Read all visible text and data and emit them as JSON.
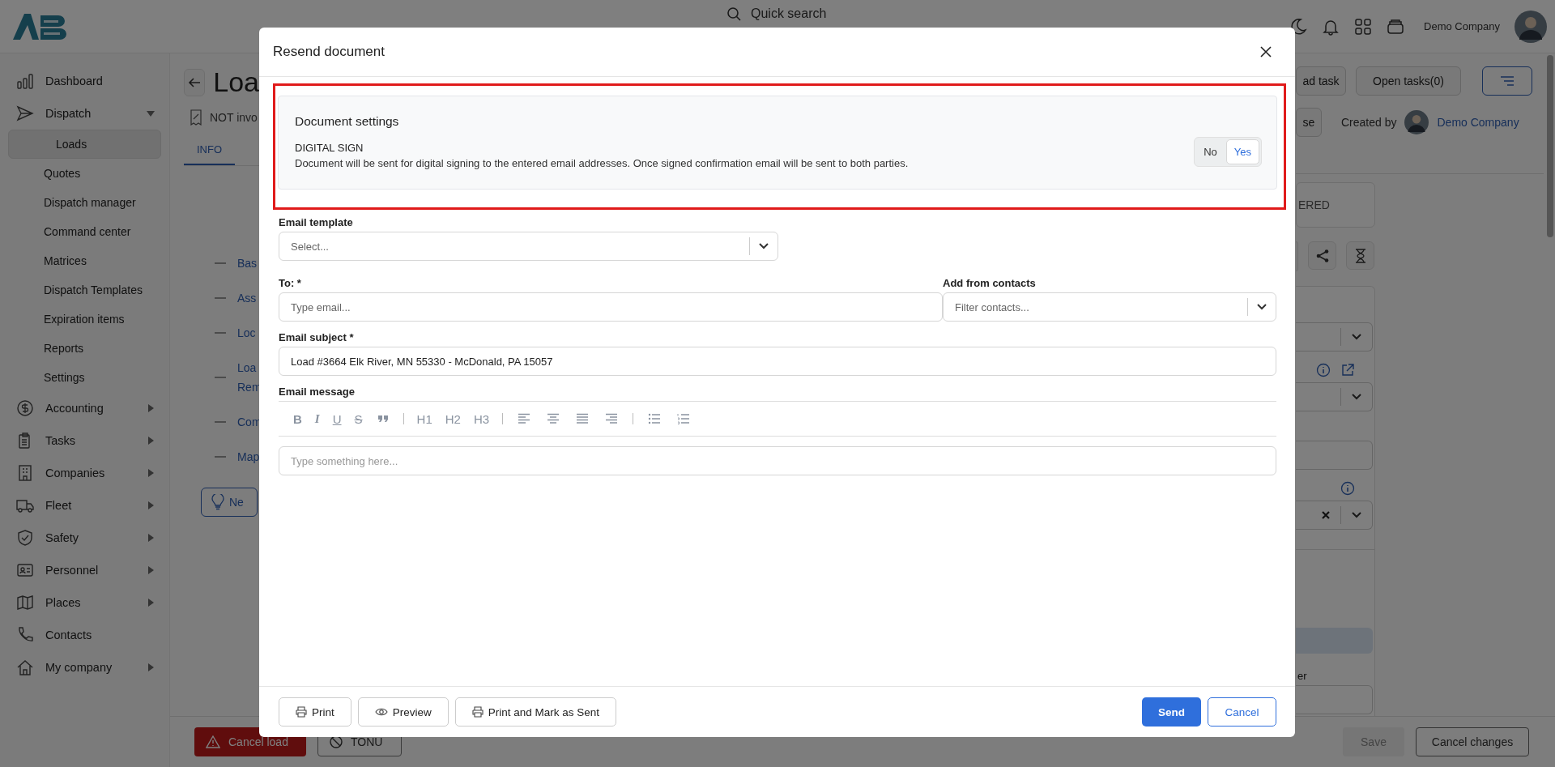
{
  "topbar": {
    "search_placeholder": "Quick search",
    "company": "Demo Company"
  },
  "sidebar": {
    "items": [
      {
        "kind": "link",
        "label": "Dashboard",
        "selected": false
      },
      {
        "kind": "menu",
        "label": "Dispatch",
        "selected": false,
        "expanded": true,
        "children": [
          {
            "label": "Loads",
            "selected": true
          },
          {
            "label": "Quotes",
            "selected": false
          },
          {
            "label": "Dispatch manager",
            "selected": false
          },
          {
            "label": "Command center",
            "selected": false
          },
          {
            "label": "Matrices",
            "selected": false
          },
          {
            "label": "Dispatch Templates",
            "selected": false
          },
          {
            "label": "Expiration items",
            "selected": false
          },
          {
            "label": "Reports",
            "selected": false
          },
          {
            "label": "Settings",
            "selected": false
          }
        ]
      },
      {
        "kind": "menu",
        "label": "Accounting",
        "selected": false,
        "expanded": false
      },
      {
        "kind": "menu",
        "label": "Tasks",
        "selected": false,
        "expanded": false
      },
      {
        "kind": "menu",
        "label": "Companies",
        "selected": false,
        "expanded": false
      },
      {
        "kind": "menu",
        "label": "Fleet",
        "selected": false,
        "expanded": false
      },
      {
        "kind": "menu",
        "label": "Safety",
        "selected": false,
        "expanded": false
      },
      {
        "kind": "menu",
        "label": "Personnel",
        "selected": false,
        "expanded": false
      },
      {
        "kind": "menu",
        "label": "Places",
        "selected": false,
        "expanded": false
      },
      {
        "kind": "link",
        "label": "Contacts",
        "selected": false
      },
      {
        "kind": "menu",
        "label": "My company",
        "selected": false,
        "expanded": false
      }
    ]
  },
  "page": {
    "title": "Loa",
    "invoice_status": "NOT invo",
    "tabs": [
      {
        "label": "INFO",
        "selected": true
      }
    ],
    "sections": [
      {
        "lines": [
          "Bas"
        ]
      },
      {
        "lines": [
          "Ass"
        ]
      },
      {
        "lines": [
          "Loc"
        ]
      },
      {
        "lines": [
          "Loa",
          "Rem"
        ]
      },
      {
        "lines": [
          "Com"
        ]
      },
      {
        "lines": [
          "Map"
        ]
      }
    ],
    "next_button": "Ne",
    "add_task_button": "ad task",
    "open_tasks_button": "Open tasks(0)",
    "status_button": "se",
    "created_by_label": "Created by",
    "created_by": "Demo Company",
    "status_card": "ERED",
    "panel_label": "er",
    "footer": {
      "cancel_load": "Cancel load",
      "tonu": "TONU",
      "save": {
        "label": "Save",
        "disabled": true
      },
      "cancel_changes": "Cancel changes"
    }
  },
  "modal": {
    "title": "Resend document",
    "settings": {
      "highlighted": true,
      "heading": "Document settings",
      "label": "DIGITAL SIGN",
      "description": "Document will be sent for digital signing to the entered email addresses. Once signed confirmation email will be sent to both parties.",
      "options": [
        {
          "label": "No",
          "selected": false
        },
        {
          "label": "Yes",
          "selected": true
        }
      ]
    },
    "email_template": {
      "label": "Email template",
      "placeholder": "Select..."
    },
    "to": {
      "label": "To: *",
      "placeholder": "Type email..."
    },
    "contacts": {
      "label": "Add from contacts",
      "placeholder": "Filter contacts..."
    },
    "subject": {
      "label": "Email subject *",
      "value": "Load #3664 Elk River, MN 55330 - McDonald, PA 15057"
    },
    "message": {
      "label": "Email message",
      "placeholder": "Type something here..."
    },
    "toolbar": [
      {
        "kind": "bold",
        "label": "B"
      },
      {
        "kind": "italic",
        "label": "I"
      },
      {
        "kind": "underline",
        "label": "U"
      },
      {
        "kind": "strike",
        "label": "S"
      },
      {
        "kind": "quote"
      },
      {
        "kind": "separator"
      },
      {
        "kind": "heading",
        "label": "H1"
      },
      {
        "kind": "heading",
        "label": "H2"
      },
      {
        "kind": "heading",
        "label": "H3"
      },
      {
        "kind": "separator"
      },
      {
        "kind": "align-left"
      },
      {
        "kind": "align-center"
      },
      {
        "kind": "align-justify"
      },
      {
        "kind": "align-right"
      },
      {
        "kind": "separator"
      },
      {
        "kind": "bullet-list"
      },
      {
        "kind": "numbered-list"
      }
    ],
    "footer_buttons": [
      {
        "kind": "print",
        "label": "Print"
      },
      {
        "kind": "preview",
        "label": "Preview"
      },
      {
        "kind": "print",
        "label": "Print and Mark as Sent"
      }
    ],
    "send_button": "Send",
    "cancel_button": "Cancel"
  }
}
